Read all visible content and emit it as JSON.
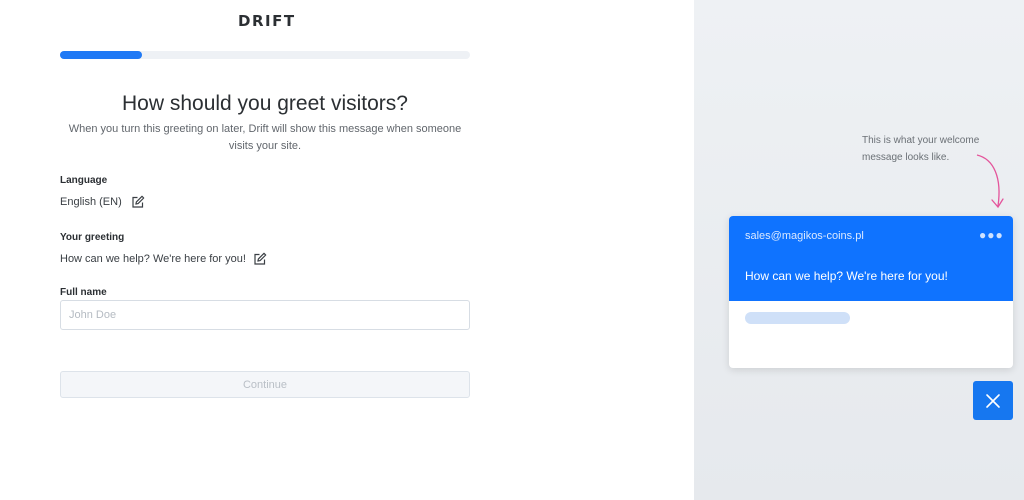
{
  "brand": {
    "logo_text": "DRIFT"
  },
  "progress": {
    "fraction": 0.2,
    "color": "#1f79f5"
  },
  "header": {
    "title": "How should you greet visitors?",
    "subtitle": "When you turn this greeting on later, Drift will show this message when someone visits your site."
  },
  "form": {
    "language": {
      "label": "Language",
      "value": "English (EN)",
      "icon": "edit-icon"
    },
    "greeting": {
      "label": "Your greeting",
      "value": "How can we help? We're here for you!",
      "icon": "edit-icon"
    },
    "full_name": {
      "label": "Full name",
      "value": "",
      "placeholder": "John Doe"
    },
    "continue_label": "Continue"
  },
  "preview": {
    "hint": "This is what your welcome message looks like.",
    "widget": {
      "email": "sales@magikos-coins.pl",
      "menu_icon": "more-dots-icon",
      "message": "How can we help? We're here for you!",
      "header_color": "#0f73ff"
    },
    "close_icon": "close-icon",
    "accent_color": "#1677f0",
    "arrow_color": "#e4549b"
  }
}
